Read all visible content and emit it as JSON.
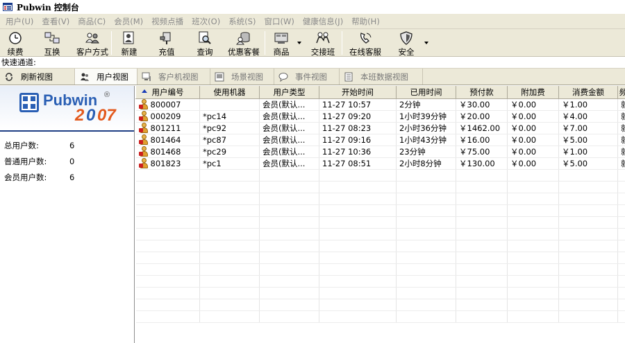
{
  "window": {
    "title": "Pubwin 控制台"
  },
  "menu": [
    {
      "name": "user",
      "label": "用户(U)"
    },
    {
      "name": "view",
      "label": "查看(V)"
    },
    {
      "name": "goods",
      "label": "商品(C)"
    },
    {
      "name": "member",
      "label": "会员(M)"
    },
    {
      "name": "vod",
      "label": "视频点播"
    },
    {
      "name": "shift",
      "label": "班次(O)"
    },
    {
      "name": "system",
      "label": "系统(S)"
    },
    {
      "name": "window",
      "label": "窗口(W)"
    },
    {
      "name": "health",
      "label": "健康信息(J)"
    },
    {
      "name": "help",
      "label": "帮助(H)"
    }
  ],
  "toolbar": {
    "renew": "续费",
    "exchange": "互换",
    "client_mode": "客户方式",
    "new": "新建",
    "recharge": "充值",
    "query": "查询",
    "vip": "优惠客餐",
    "goods": "商品",
    "handover": "交接班",
    "online_service": "在线客服",
    "security": "安全"
  },
  "quick": {
    "label": "快速通道:",
    "value": ""
  },
  "tabs": {
    "refresh": "刷新视图",
    "user_view": "用户视图",
    "client_view": "客户机视图",
    "scene_view": "场景视图",
    "event_view": "事件视图",
    "shift_data_view": "本班数据视图"
  },
  "logo": {
    "text": "Pubwin",
    "reg": "®",
    "year_a": "2",
    "year_b": "0",
    "year_c": "07"
  },
  "stats": {
    "total_label": "总用户数:",
    "total_value": "6",
    "normal_label": "普通用户数:",
    "normal_value": "0",
    "member_label": "会员用户数:",
    "member_value": "6"
  },
  "grid": {
    "columns": [
      "用户编号",
      "使用机器",
      "用户类型",
      "开始时间",
      "已用时间",
      "预付款",
      "附加费",
      "消费金额",
      "频"
    ],
    "rows": [
      [
        "800007",
        "",
        "会员(默认...",
        "11-27 10:57",
        "2分钟",
        "￥30.00",
        "￥0.00",
        "￥1.00",
        "就"
      ],
      [
        "000209",
        "*pc14",
        "会员(默认...",
        "11-27 09:20",
        "1小时39分钟",
        "￥20.00",
        "￥0.00",
        "￥4.00",
        "就"
      ],
      [
        "801211",
        "*pc92",
        "会员(默认...",
        "11-27 08:23",
        "2小时36分钟",
        "￥1462.00",
        "￥0.00",
        "￥7.00",
        "就"
      ],
      [
        "801464",
        "*pc87",
        "会员(默认...",
        "11-27 09:16",
        "1小时43分钟",
        "￥16.00",
        "￥0.00",
        "￥5.00",
        "就"
      ],
      [
        "801468",
        "*pc29",
        "会员(默认...",
        "11-27 10:36",
        "23分钟",
        "￥75.00",
        "￥0.00",
        "￥1.00",
        "就"
      ],
      [
        "801823",
        "*pc1",
        "会员(默认...",
        "11-27 08:51",
        "2小时8分钟",
        "￥130.00",
        "￥0.00",
        "￥5.00",
        "就"
      ]
    ]
  }
}
